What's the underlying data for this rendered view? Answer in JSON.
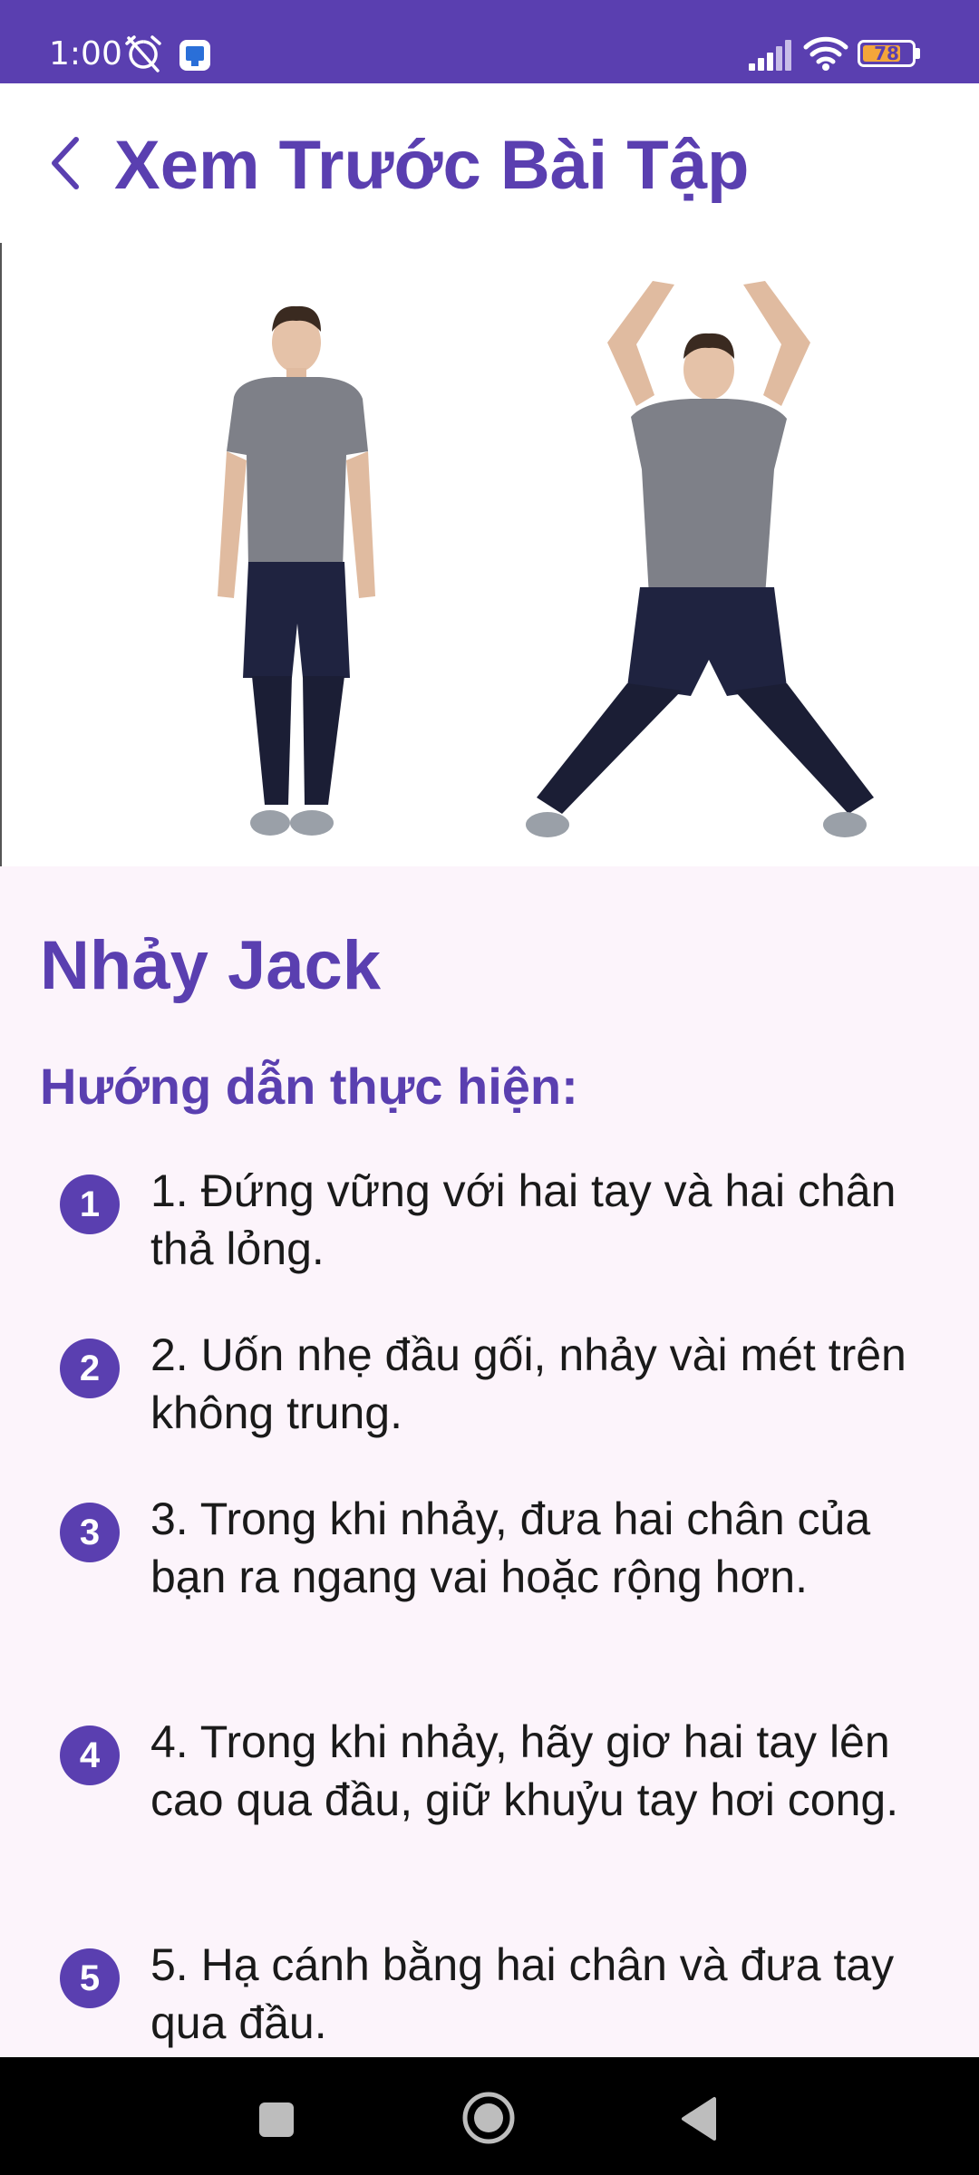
{
  "status_bar": {
    "time": "1:00",
    "battery": "78",
    "battery_level": 0.78
  },
  "header": {
    "title": "Xem Trước Bài Tập"
  },
  "exercise": {
    "name": "Nhảy Jack",
    "instructions_title": "Hướng dẫn thực hiện:",
    "steps": [
      {
        "badge": "1",
        "text": "1. Đứng vững với hai tay và hai chân thả lỏng."
      },
      {
        "badge": "2",
        "text": "2. Uốn nhẹ đầu gối, nhảy vài mét trên không trung."
      },
      {
        "badge": "3",
        "text": "3. Trong khi nhảy, đưa hai chân của bạn ra ngang vai hoặc rộng hơn."
      },
      {
        "badge": "4",
        "text": "4. Trong khi nhảy, hãy giơ hai tay lên cao qua đầu, giữ khuỷu tay hơi cong."
      },
      {
        "badge": "5",
        "text": "5. Hạ cánh bằng hai chân và đưa tay qua đầu."
      }
    ]
  },
  "colors": {
    "primary": "#5a3fb0",
    "content_bg": "#fcf4fb",
    "battery": "#f4a63a"
  },
  "icons": {
    "back": "chevron-left-icon",
    "nav_recents": "square-icon",
    "nav_home": "circle-icon",
    "nav_back": "triangle-back-icon"
  }
}
